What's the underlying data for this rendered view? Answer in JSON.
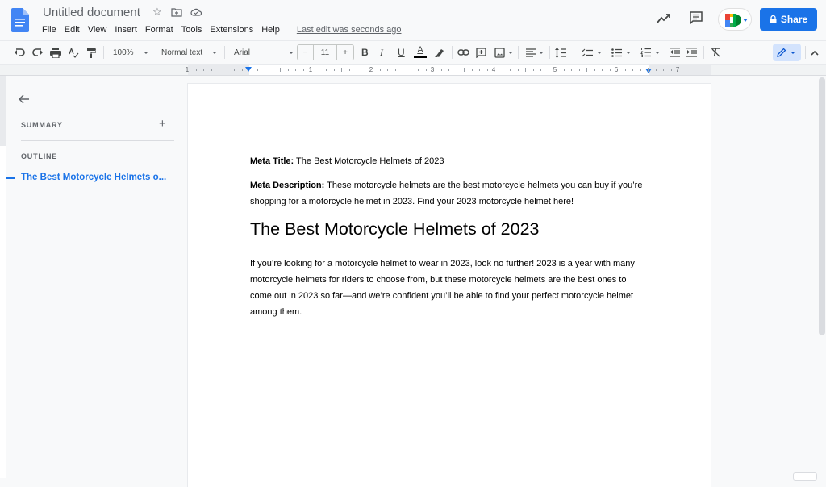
{
  "app": {
    "title": "Untitled document",
    "menu": [
      "File",
      "Edit",
      "View",
      "Insert",
      "Format",
      "Tools",
      "Extensions",
      "Help"
    ],
    "last_edit": "Last edit was seconds ago",
    "share_label": "Share",
    "accent": "#1a73e8"
  },
  "toolbar": {
    "zoom": "100%",
    "style": "Normal text",
    "font": "Arial",
    "font_size": "11",
    "minus": "−",
    "plus": "+",
    "bold": "B",
    "italic": "I",
    "underline": "U",
    "text_color": "A"
  },
  "ruler": {
    "numbers": [
      "1",
      "1",
      "2",
      "3",
      "4",
      "5",
      "6",
      "7"
    ]
  },
  "outline_panel": {
    "summary_label": "SUMMARY",
    "summary_add": "+",
    "outline_label": "OUTLINE",
    "items": [
      {
        "label": "The Best Motorcycle Helmets o..."
      }
    ]
  },
  "document": {
    "meta_title_label": "Meta Title:",
    "meta_title_value": " The Best Motorcycle Helmets of 2023",
    "meta_desc_label": "Meta Description:",
    "meta_desc_value": " These motorcycle helmets are the best motorcycle helmets you can buy if you’re shopping for a motorcycle helmet in 2023. Find your 2023 motorcycle helmet here!",
    "heading": "The Best Motorcycle Helmets of 2023",
    "body": "If you’re looking for a motorcycle helmet to wear in 2023, look no further! 2023 is a year with many motorcycle helmets for riders to choose from, but these motorcycle helmets are the best ones to come out in 2023 so far—and we’re confident you’ll be able to find your perfect motorcycle helmet among them."
  }
}
